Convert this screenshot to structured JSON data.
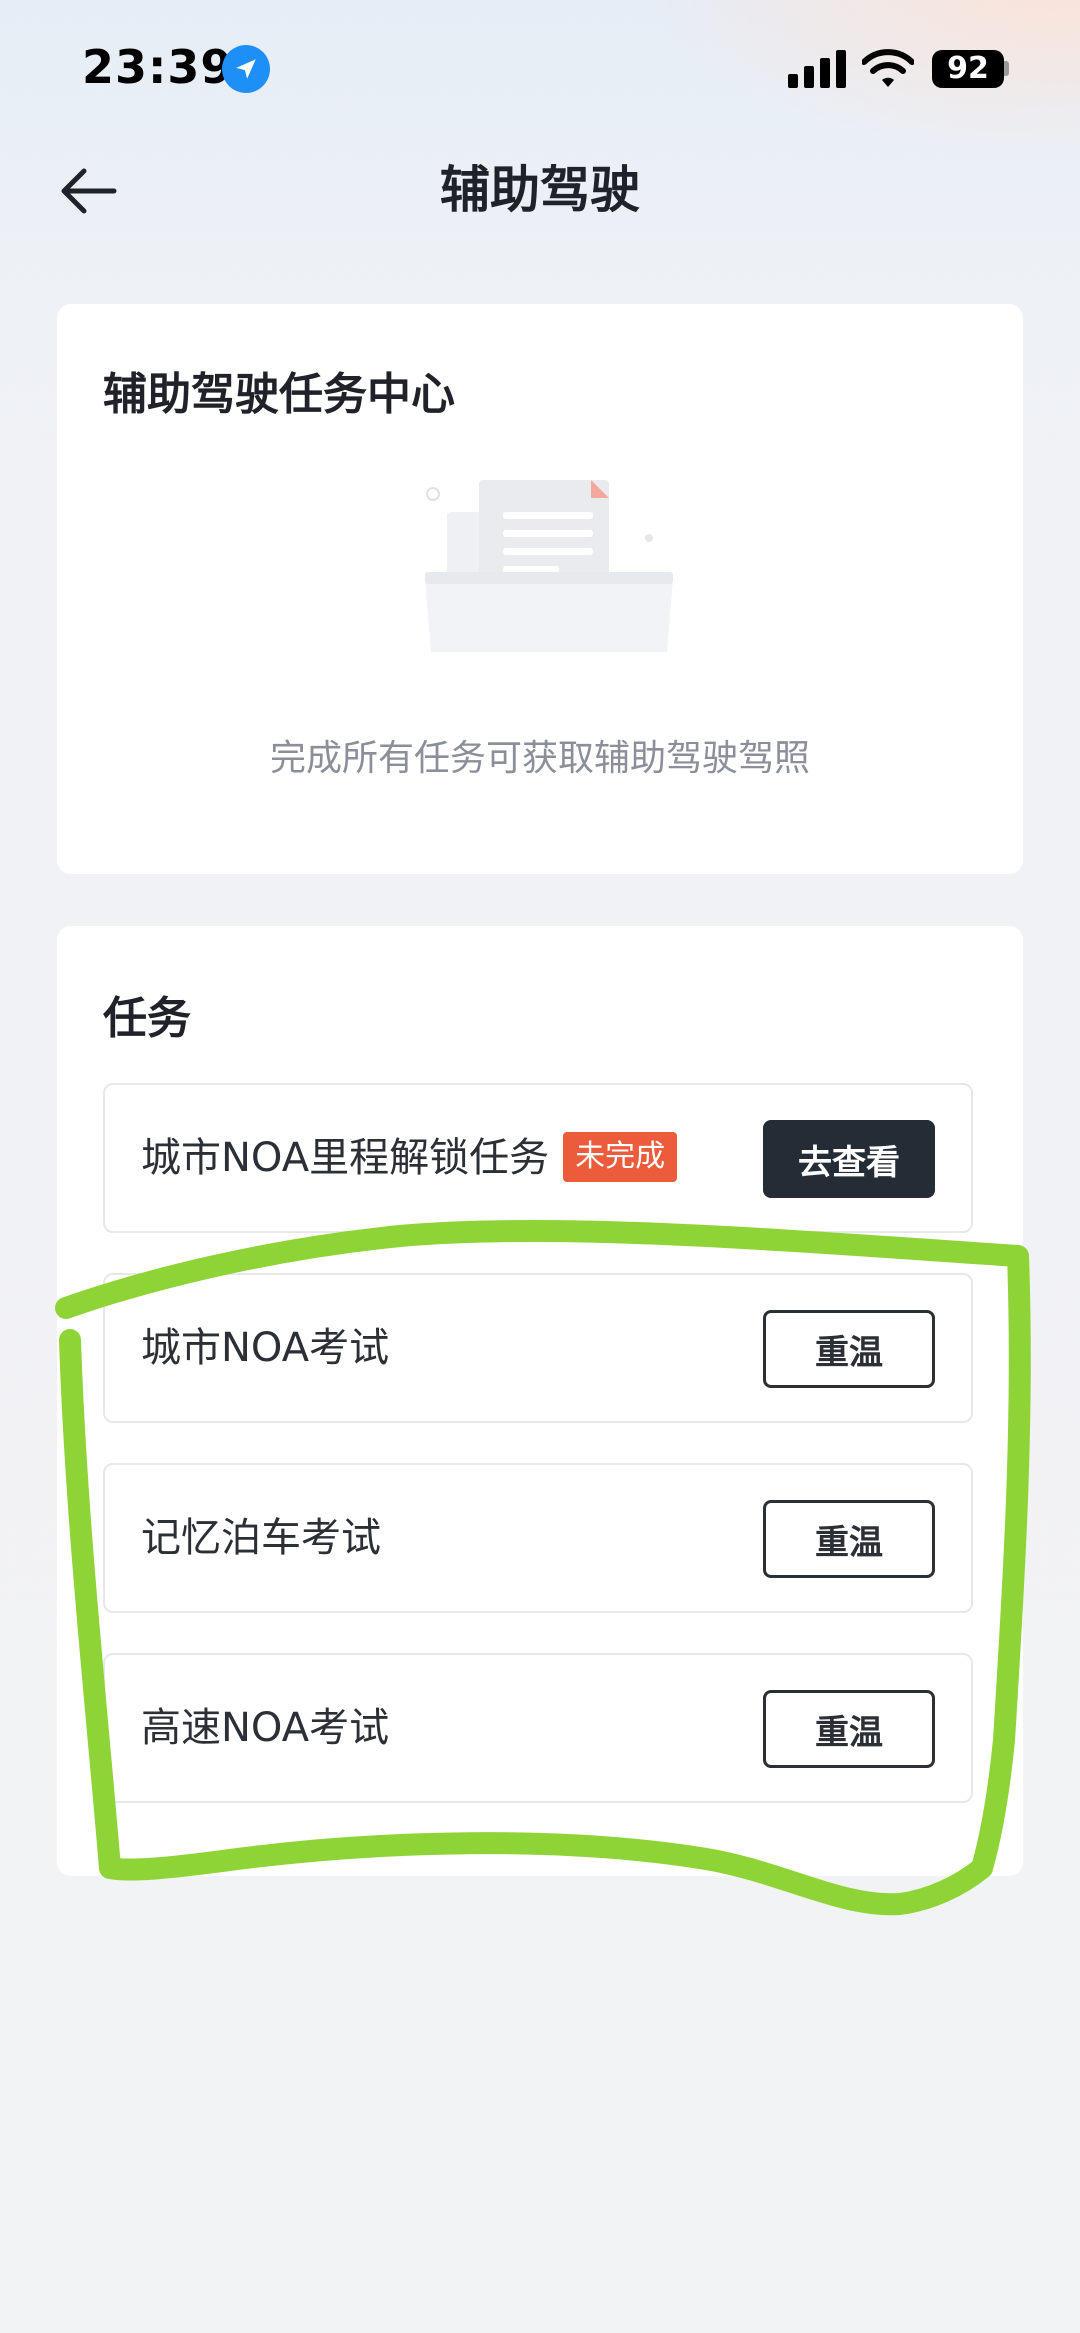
{
  "status_bar": {
    "time": "23:39",
    "battery": "92"
  },
  "header": {
    "title": "辅助驾驶"
  },
  "task_center": {
    "title": "辅助驾驶任务中心",
    "empty_message": "完成所有任务可获取辅助驾驶驾照"
  },
  "tasks": {
    "title": "任务",
    "items": [
      {
        "name": "城市NOA里程解锁任务",
        "badge": "未完成",
        "action": "去查看"
      },
      {
        "name": "城市NOA考试",
        "action": "重温"
      },
      {
        "name": "记忆泊车考试",
        "action": "重温"
      },
      {
        "name": "高速NOA考试",
        "action": "重温"
      }
    ]
  },
  "colors": {
    "badge": "#ec5b3c",
    "primary_button": "#242c36",
    "annotation_stroke": "#8fd436"
  }
}
